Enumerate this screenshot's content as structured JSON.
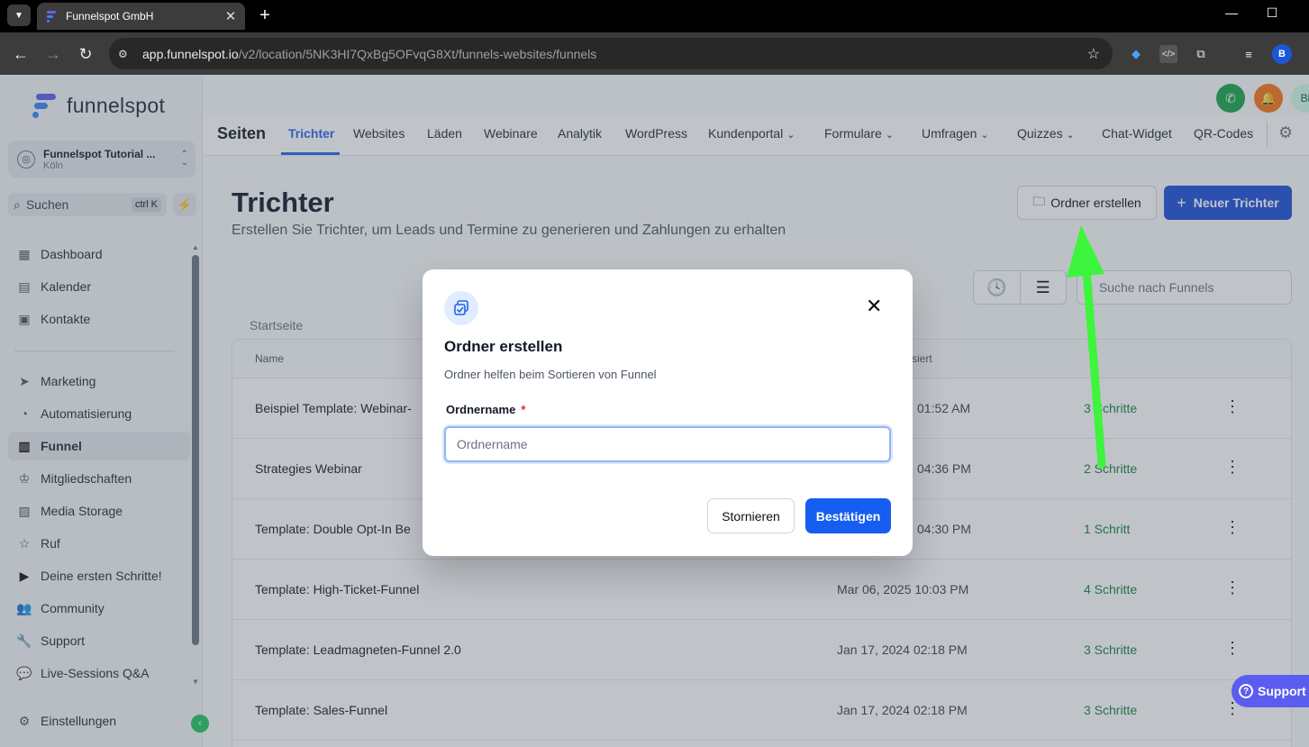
{
  "browser": {
    "tab_title": "Funnelspot GmbH",
    "url_host": "app.funnelspot.io",
    "url_path": "/v2/location/5NK3HI7QxBg5OFvqG8Xt/funnels-websites/funnels",
    "profile_initial": "B"
  },
  "sidebar": {
    "logo_text": "funnelspot",
    "account_name": "Funnelspot Tutorial ...",
    "account_city": "Köln",
    "search_label": "Suchen",
    "search_shortcut": "ctrl K",
    "items_top": [
      {
        "label": "Dashboard",
        "icon": "grid-icon"
      },
      {
        "label": "Kalender",
        "icon": "calendar-icon"
      },
      {
        "label": "Kontakte",
        "icon": "contacts-icon"
      }
    ],
    "items_bottom": [
      {
        "label": "Marketing",
        "icon": "send-icon"
      },
      {
        "label": "Automatisierung",
        "icon": "automation-icon"
      },
      {
        "label": "Funnel",
        "icon": "funnel-icon",
        "active": true
      },
      {
        "label": "Mitgliedschaften",
        "icon": "membership-icon"
      },
      {
        "label": "Media Storage",
        "icon": "image-icon"
      },
      {
        "label": "Ruf",
        "icon": "star-icon"
      },
      {
        "label": "Deine ersten Schritte!",
        "icon": "play-icon"
      },
      {
        "label": "Community",
        "icon": "community-icon"
      },
      {
        "label": "Support",
        "icon": "wrench-icon"
      },
      {
        "label": "Live-Sessions Q&A",
        "icon": "chat-icon"
      }
    ],
    "settings_label": "Einstellungen"
  },
  "header": {
    "avatar_initials": "Bl",
    "section_title": "Seiten",
    "tabs": [
      {
        "label": "Trichter",
        "active": true
      },
      {
        "label": "Websites"
      },
      {
        "label": "Läden"
      },
      {
        "label": "Webinare"
      },
      {
        "label": "Analytik"
      },
      {
        "label": "WordPress"
      },
      {
        "label": "Kundenportal",
        "dropdown": true
      },
      {
        "label": "Formulare",
        "dropdown": true
      },
      {
        "label": "Umfragen",
        "dropdown": true
      },
      {
        "label": "Quizzes",
        "dropdown": true
      },
      {
        "label": "Chat-Widget"
      },
      {
        "label": "QR-Codes"
      }
    ]
  },
  "page": {
    "title": "Trichter",
    "subtitle": "Erstellen Sie Trichter, um Leads und Termine zu generieren und Zahlungen zu erhalten",
    "create_folder_label": "Ordner erstellen",
    "new_funnel_label": "Neuer Trichter",
    "search_placeholder": "Suche nach Funnels",
    "breadcrumb": "Startseite"
  },
  "table": {
    "col_name": "Name",
    "col_updated": "siert",
    "rows": [
      {
        "name": "Beispiel Template: Webinar-",
        "date": "01:52 AM",
        "steps": "3 Schritte"
      },
      {
        "name": "Strategies Webinar",
        "date": "04:36 PM",
        "steps": "2 Schritte"
      },
      {
        "name": "Template: Double Opt-In Be",
        "date": "04:30 PM",
        "steps": "1 Schritt"
      },
      {
        "name": "Template: High-Ticket-Funnel",
        "date": "Mar 06, 2025 10:03 PM",
        "steps": "4 Schritte"
      },
      {
        "name": "Template: Leadmagneten-Funnel 2.0",
        "date": "Jan 17, 2024 02:18 PM",
        "steps": "3 Schritte"
      },
      {
        "name": "Template: Sales-Funnel",
        "date": "Jan 17, 2024 02:18 PM",
        "steps": "3 Schritte"
      }
    ]
  },
  "modal": {
    "title": "Ordner erstellen",
    "description": "Ordner helfen beim Sortieren von Funnel",
    "field_label": "Ordnername",
    "required_mark": "*",
    "field_placeholder": "Ordnername",
    "field_value": "",
    "cancel_label": "Stornieren",
    "confirm_label": "Bestätigen"
  },
  "support_label": "Support",
  "colors": {
    "accent": "#155eef",
    "success": "#15803d",
    "arrow": "#3cf53c"
  }
}
